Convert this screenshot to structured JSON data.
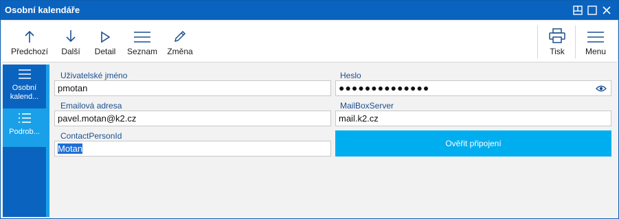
{
  "window": {
    "title": "Osobní kalendáře"
  },
  "toolbar": {
    "previous_label": "Předchozí",
    "next_label": "Další",
    "detail_label": "Detail",
    "list_label": "Seznam",
    "edit_label": "Změna",
    "print_label": "Tisk",
    "menu_label": "Menu"
  },
  "sidebar": {
    "items": [
      {
        "label": "Osobní kalend..."
      },
      {
        "label": "Podrob..."
      }
    ]
  },
  "form": {
    "username": {
      "label": "Uživatelské jméno",
      "value": "pmotan"
    },
    "password": {
      "label": "Heslo",
      "value": "●●●●●●●●●●●●●●"
    },
    "email": {
      "label": "Emailová adresa",
      "value": "pavel.motan@k2.cz"
    },
    "mailbox_server": {
      "label": "MailBoxServer",
      "value": "mail.k2.cz"
    },
    "contact_person": {
      "label": "ContactPersonId",
      "value": "Motan"
    },
    "verify_button": "Ověřit připojení"
  },
  "colors": {
    "accent": "#0b63c0",
    "highlight": "#1aa0e8",
    "button": "#00aeef"
  }
}
